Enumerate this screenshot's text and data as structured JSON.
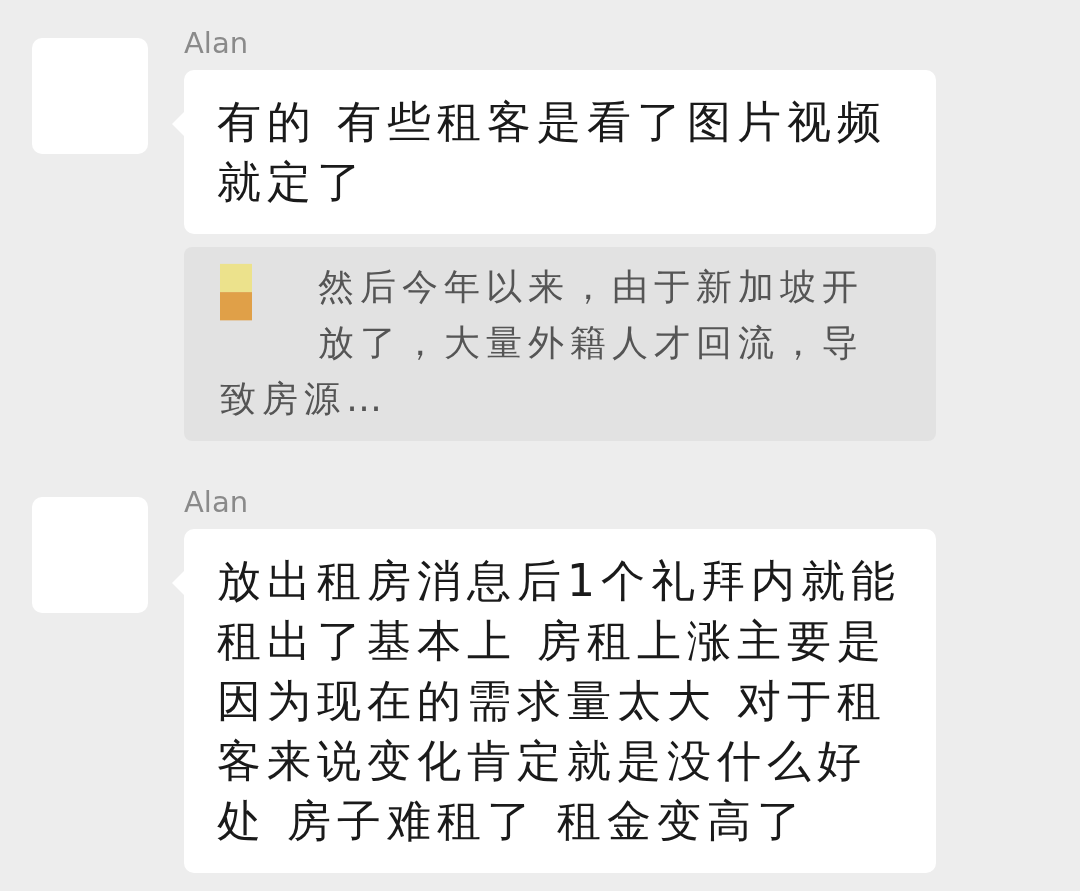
{
  "messages": [
    {
      "sender": "Alan",
      "text": "有的 有些租客是看了图片视频就定了",
      "quote": "然后今年以来，由于新加坡开放了，大量外籍人才回流，导致房源…"
    },
    {
      "sender": "Alan",
      "text": "放出租房消息后1个礼拜内就能租出了基本上 房租上涨主要是因为现在的需求量太大 对于租客来说变化肯定就是没什么好处 房子难租了 租金变高了"
    }
  ]
}
